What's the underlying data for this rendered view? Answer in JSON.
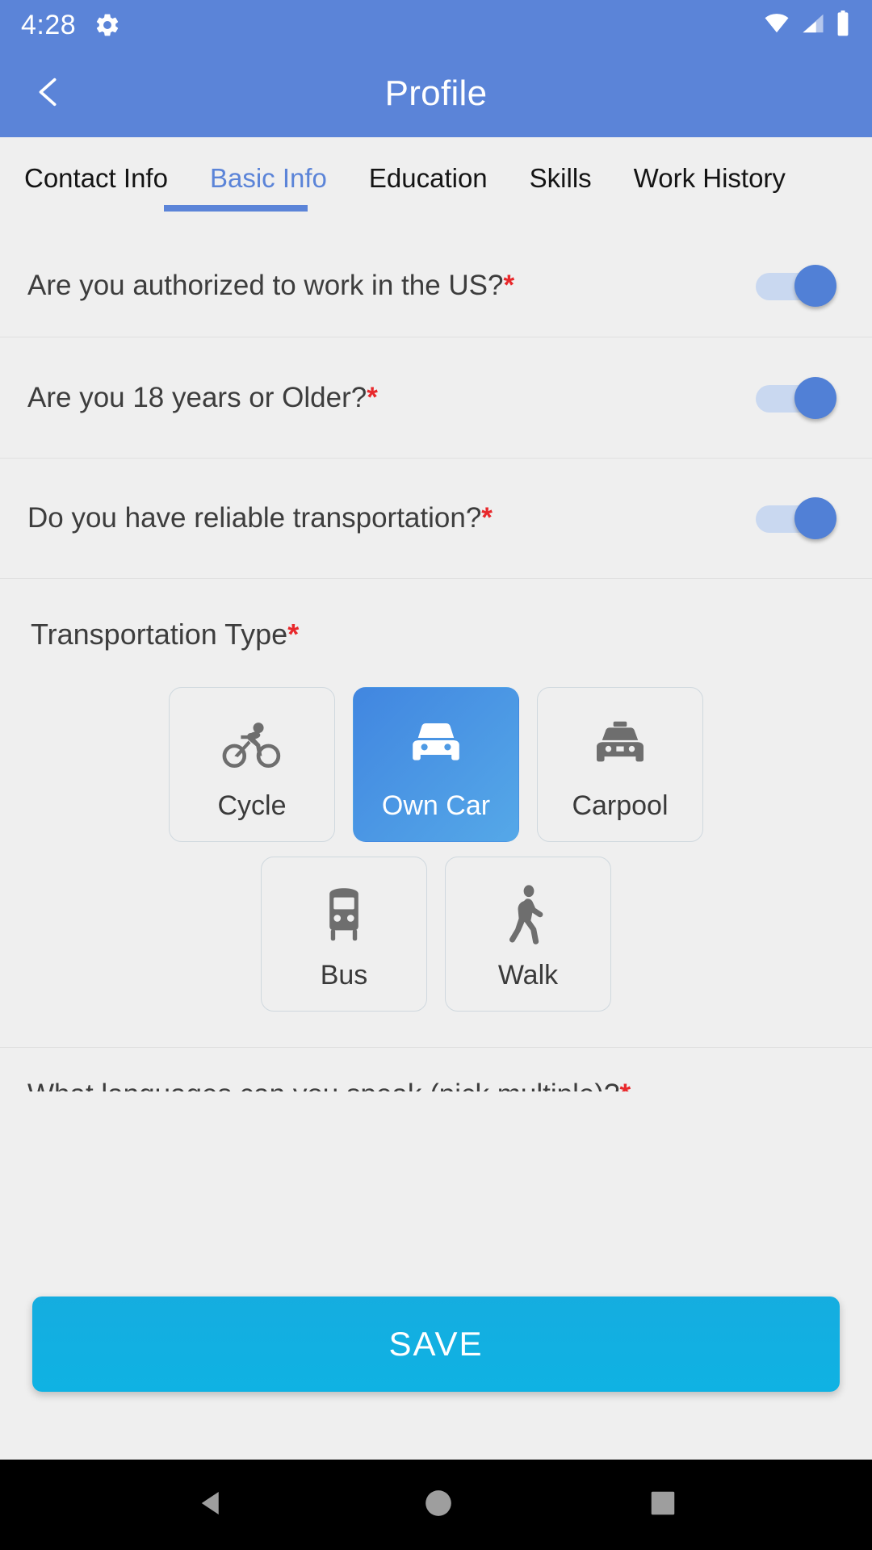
{
  "status_bar": {
    "time": "4:28",
    "icons": [
      "gear-icon",
      "wifi-icon",
      "cellular-signal-icon",
      "battery-icon"
    ]
  },
  "app_bar": {
    "title": "Profile",
    "back_icon": "chevron-left-icon"
  },
  "tabs": [
    {
      "label": "Contact Info",
      "active": false
    },
    {
      "label": "Basic Info",
      "active": true
    },
    {
      "label": "Education",
      "active": false
    },
    {
      "label": "Skills",
      "active": false
    },
    {
      "label": "Work History",
      "active": false
    }
  ],
  "questions": [
    {
      "text": "Are you authorized to work in the US?",
      "required": true,
      "toggle_on": true
    },
    {
      "text": "Are you 18 years or Older?",
      "required": true,
      "toggle_on": true
    },
    {
      "text": "Do you have reliable transportation?",
      "required": true,
      "toggle_on": true
    }
  ],
  "transportation": {
    "label": "Transportation Type",
    "required": true,
    "options": [
      {
        "label": "Cycle",
        "icon": "bicycle-icon",
        "selected": false
      },
      {
        "label": "Own Car",
        "icon": "car-icon",
        "selected": true
      },
      {
        "label": "Carpool",
        "icon": "taxi-icon",
        "selected": false
      },
      {
        "label": "Bus",
        "icon": "bus-icon",
        "selected": false
      },
      {
        "label": "Walk",
        "icon": "walk-icon",
        "selected": false
      }
    ]
  },
  "languages_question": {
    "text": "What languages can you speak (pick multiple)?",
    "required": true
  },
  "save_button": {
    "label": "SAVE"
  },
  "nav_bar": {
    "back": "triangle-back-icon",
    "home": "circle-home-icon",
    "recents": "square-recents-icon"
  },
  "colors": {
    "header_blue": "#5b84d8",
    "accent_blue": "#5b84d8",
    "selected_card_from": "#4186e0",
    "selected_card_to": "#55a8e8",
    "save_cyan": "#0fb2e3",
    "required_red": "#e8282b",
    "page_bg": "#efefef"
  }
}
